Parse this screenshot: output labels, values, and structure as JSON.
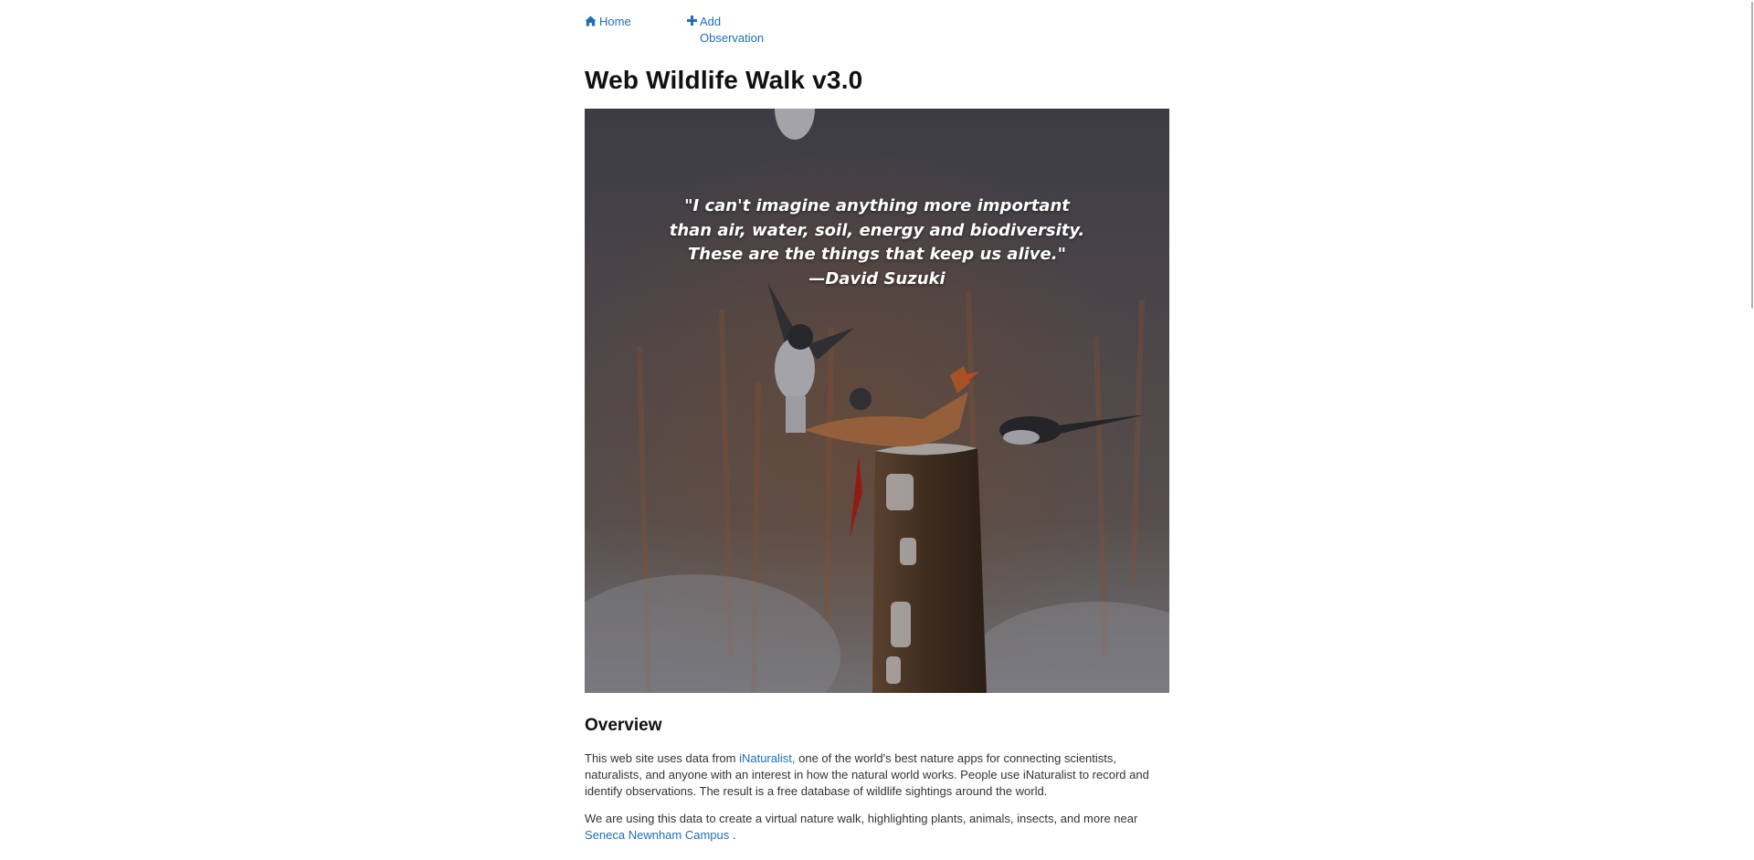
{
  "nav": {
    "home_label": "Home",
    "add_label": "Add Observation",
    "home_icon": "home-icon",
    "add_icon": "plus-icon"
  },
  "header": {
    "title": "Web Wildlife Walk v3.0"
  },
  "hero": {
    "quote_lines": [
      "\"I can't imagine anything more important",
      "than air, water, soil, energy and biodiversity.",
      "These are the things that keep us alive.\"",
      "—David Suzuki"
    ]
  },
  "overview": {
    "heading": "Overview",
    "p1_prefix": "This web site uses data from ",
    "p1_link": "iNaturalist,",
    "p1_suffix": " one of the world's best nature apps for connecting scientists, naturalists, and anyone with an interest in how the natural world works. People use iNaturalist to record and identify observations. The result is a free database of wildlife sightings around the world.",
    "p2_prefix": "We are using this data to create a virtual nature walk, highlighting plants, animals, insects, and more near ",
    "p2_link": "Seneca Newnham Campus",
    "p2_suffix": " ."
  },
  "colors": {
    "link": "#1f6fb5",
    "heading": "#111111"
  }
}
